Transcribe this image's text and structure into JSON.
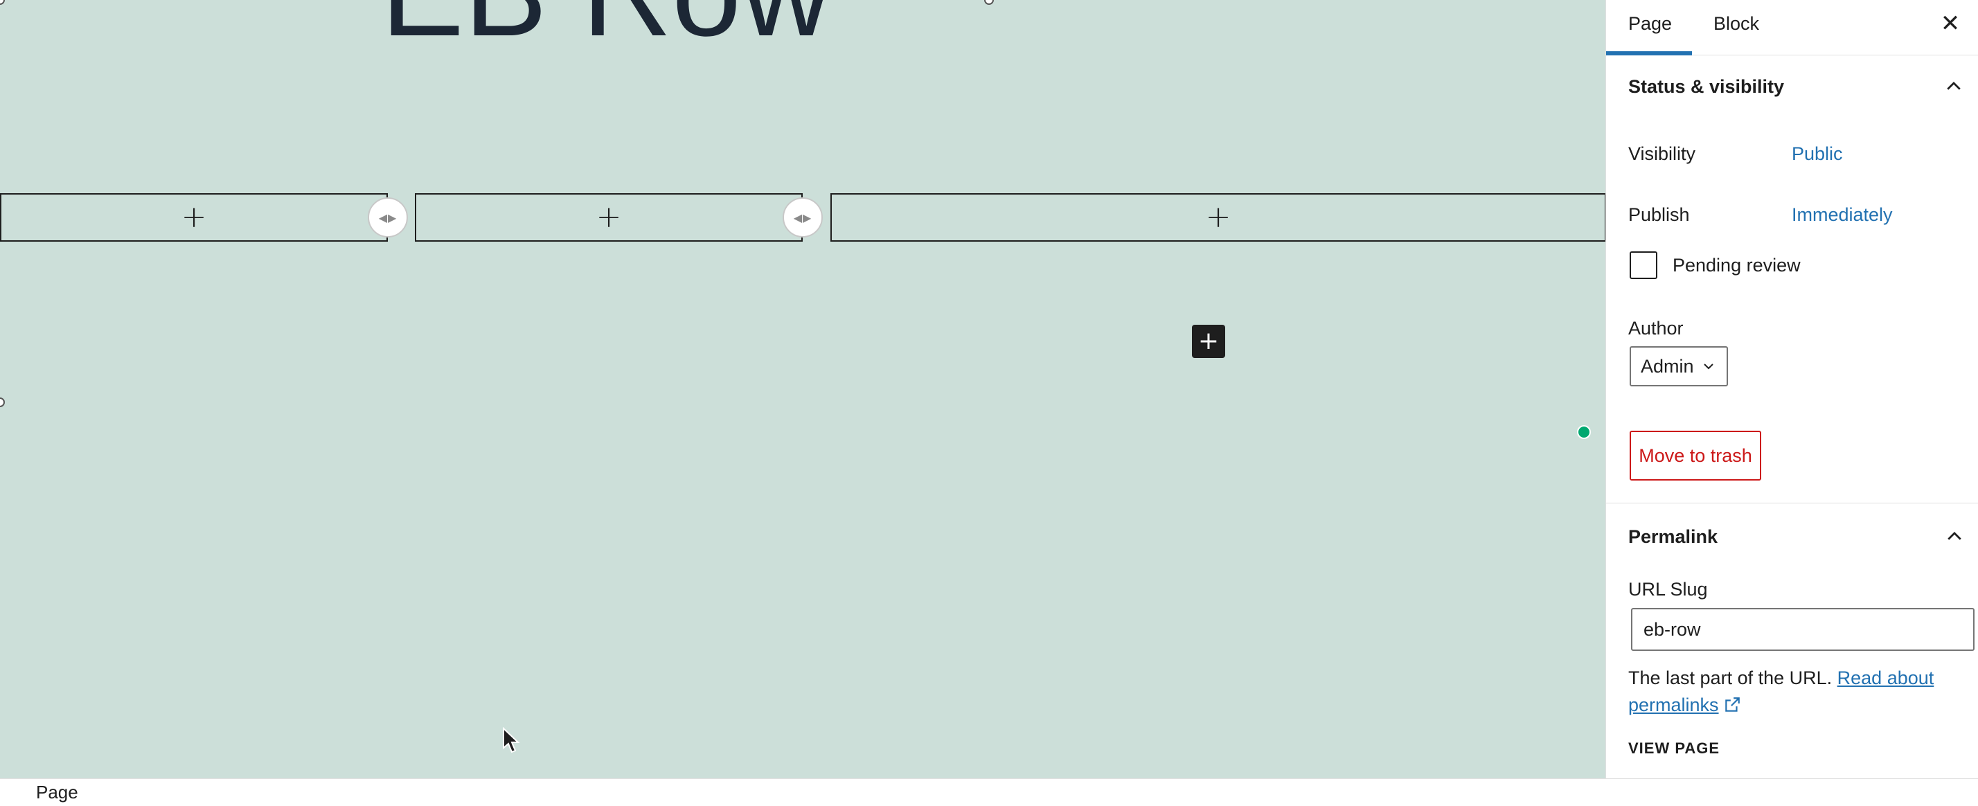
{
  "canvas": {
    "block_title": "EB Row",
    "column_add_symbol": "+",
    "inserter_symbol": "+"
  },
  "footer": {
    "breadcrumb": "Page"
  },
  "sidebar": {
    "tabs": [
      {
        "label": "Page",
        "active": true
      },
      {
        "label": "Block",
        "active": false
      }
    ],
    "close_symbol": "✕",
    "status_visibility": {
      "heading": "Status & visibility",
      "visibility_label": "Visibility",
      "visibility_value": "Public",
      "publish_label": "Publish",
      "publish_value": "Immediately",
      "pending_review_label": "Pending review",
      "pending_review_checked": false,
      "author_label": "Author",
      "author_value": "Admin",
      "trash_label": "Move to trash"
    },
    "permalink": {
      "heading": "Permalink",
      "slug_label": "URL Slug",
      "slug_value": "eb-row",
      "help_text": "The last part of the URL.",
      "help_link": "Read about permalinks",
      "view_page": "VIEW PAGE"
    }
  },
  "colors": {
    "canvas_bg": "#ccdfd9",
    "accent": "#2271b1",
    "danger": "#cc1818",
    "indicator": "#00a870"
  },
  "icons": {
    "close": "close-icon",
    "chevron": "chevron-up-icon",
    "resize": "resize-handle-icon",
    "external": "external-link-icon"
  }
}
